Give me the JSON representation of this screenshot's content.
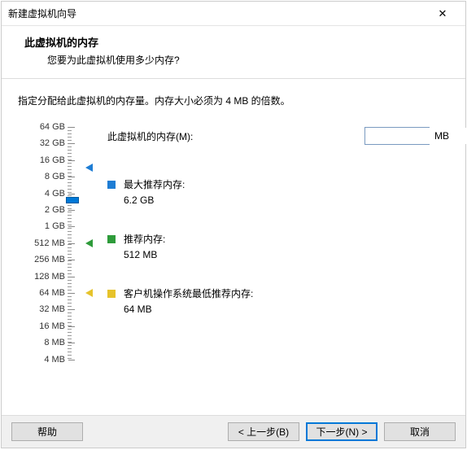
{
  "window": {
    "title": "新建虚拟机向导"
  },
  "header": {
    "title": "此虚拟机的内存",
    "subtitle": "您要为此虚拟机使用多少内存?"
  },
  "instruction": "指定分配给此虚拟机的内存量。内存大小必须为 4 MB 的倍数。",
  "memory": {
    "label": "此虚拟机的内存(M):",
    "value": "3072",
    "unit": "MB"
  },
  "ticks": [
    {
      "label": "64 GB",
      "pos": 0
    },
    {
      "label": "32 GB",
      "pos": 20.4
    },
    {
      "label": "16 GB",
      "pos": 40.8
    },
    {
      "label": "8 GB",
      "pos": 61.2
    },
    {
      "label": "4 GB",
      "pos": 81.6
    },
    {
      "label": "2 GB",
      "pos": 102
    },
    {
      "label": "1 GB",
      "pos": 122.4
    },
    {
      "label": "512 MB",
      "pos": 142.8
    },
    {
      "label": "256 MB",
      "pos": 163.2
    },
    {
      "label": "128 MB",
      "pos": 183.6
    },
    {
      "label": "64 MB",
      "pos": 204
    },
    {
      "label": "32 MB",
      "pos": 224.4
    },
    {
      "label": "16 MB",
      "pos": 244.8
    },
    {
      "label": "8 MB",
      "pos": 265.2
    },
    {
      "label": "4 MB",
      "pos": 285.6
    }
  ],
  "slider": {
    "pos": 90
  },
  "markers": {
    "max": {
      "color": "#1e7dd4",
      "pos": 50
    },
    "rec": {
      "color": "#2e9b3a",
      "pos": 142.8
    },
    "min": {
      "color": "#e6c32b",
      "pos": 204
    }
  },
  "legend": {
    "max": {
      "label": "最大推荐内存:",
      "value": "6.2 GB",
      "color": "#1e7dd4"
    },
    "rec": {
      "label": "推荐内存:",
      "value": "512 MB",
      "color": "#2e9b3a"
    },
    "min": {
      "label": "客户机操作系统最低推荐内存:",
      "value": "64 MB",
      "color": "#e6c32b"
    }
  },
  "buttons": {
    "help": "帮助",
    "back": "< 上一步(B)",
    "next": "下一步(N) >",
    "cancel": "取消"
  }
}
